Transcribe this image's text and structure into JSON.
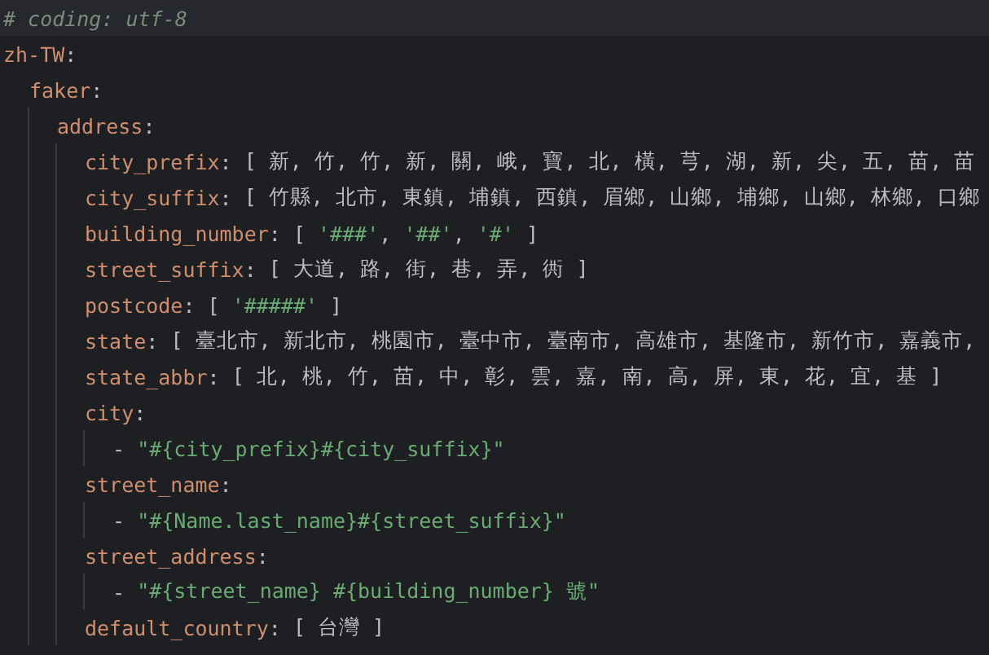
{
  "comment": "# coding: utf-8",
  "tree": [
    {
      "key": "zh-TW",
      "sep": ":",
      "children": [
        {
          "key": "faker",
          "sep": ":",
          "children": [
            {
              "key": "address",
              "sep": ":",
              "children": [
                {
                  "key": "city_prefix",
                  "sep": ":",
                  "value": [
                    {
                      "kind": "plain",
                      "text": "[ 新, 竹, 竹, 新, 關, 峨, 寶, 北, 橫, 芎, 湖, 新, 尖, 五, 苗, 苗"
                    }
                  ]
                },
                {
                  "key": "city_suffix",
                  "sep": ":",
                  "value": [
                    {
                      "kind": "plain",
                      "text": "[ 竹縣, 北市, 東鎮, 埔鎮, 西鎮, 眉鄉, 山鄉, 埔鄉, 山鄉, 林鄉, 口鄉"
                    }
                  ]
                },
                {
                  "key": "building_number",
                  "sep": ":",
                  "value": [
                    {
                      "kind": "plain",
                      "text": "[ "
                    },
                    {
                      "kind": "string",
                      "text": "'###'"
                    },
                    {
                      "kind": "plain",
                      "text": ", "
                    },
                    {
                      "kind": "string",
                      "text": "'##'"
                    },
                    {
                      "kind": "plain",
                      "text": ", "
                    },
                    {
                      "kind": "string",
                      "text": "'#'"
                    },
                    {
                      "kind": "plain",
                      "text": " ]"
                    }
                  ]
                },
                {
                  "key": "street_suffix",
                  "sep": ":",
                  "value": [
                    {
                      "kind": "plain",
                      "text": "[ 大道, 路, 街, 巷, 弄, 衖 ]"
                    }
                  ]
                },
                {
                  "key": "postcode",
                  "sep": ":",
                  "value": [
                    {
                      "kind": "plain",
                      "text": "[ "
                    },
                    {
                      "kind": "string",
                      "text": "'#####'"
                    },
                    {
                      "kind": "plain",
                      "text": " ]"
                    }
                  ]
                },
                {
                  "key": "state",
                  "sep": ":",
                  "value": [
                    {
                      "kind": "plain",
                      "text": "[ 臺北市, 新北市, 桃園市, 臺中市, 臺南市, 高雄市, 基隆市, 新竹市, 嘉義市,"
                    }
                  ]
                },
                {
                  "key": "state_abbr",
                  "sep": ":",
                  "value": [
                    {
                      "kind": "plain",
                      "text": "[ 北, 桃, 竹, 苗, 中, 彰, 雲, 嘉, 南, 高, 屏, 東, 花, 宜, 基 ]"
                    }
                  ]
                },
                {
                  "key": "city",
                  "sep": ":",
                  "children": [
                    {
                      "dash": "-",
                      "value": [
                        {
                          "kind": "string",
                          "text": "\"#{city_prefix}#{city_suffix}\""
                        }
                      ]
                    }
                  ]
                },
                {
                  "key": "street_name",
                  "sep": ":",
                  "children": [
                    {
                      "dash": "-",
                      "value": [
                        {
                          "kind": "string",
                          "text": "\"#{Name.last_name}#{street_suffix}\""
                        }
                      ]
                    }
                  ]
                },
                {
                  "key": "street_address",
                  "sep": ":",
                  "children": [
                    {
                      "dash": "-",
                      "value": [
                        {
                          "kind": "string",
                          "text": "\"#{street_name} #{building_number} 號\""
                        }
                      ]
                    }
                  ]
                },
                {
                  "key": "default_country",
                  "sep": ":",
                  "value": [
                    {
                      "kind": "plain",
                      "text": "[ 台灣 ]"
                    }
                  ]
                }
              ]
            }
          ]
        }
      ]
    }
  ]
}
